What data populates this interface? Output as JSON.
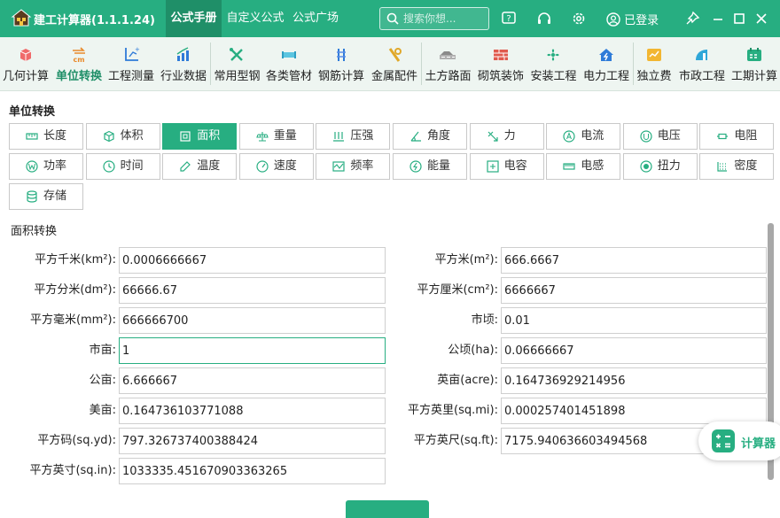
{
  "app": {
    "title": "建工计算器(1.1.1.24)",
    "brand_color": "#27ae81"
  },
  "menu": [
    "公式手册",
    "自定义公式",
    "公式广场"
  ],
  "search": {
    "placeholder": "搜索你想..."
  },
  "user": {
    "status": "已登录"
  },
  "toolbar": [
    {
      "label": "几何计算",
      "icon": "cube-icon"
    },
    {
      "label": "单位转换",
      "icon": "cm-convert-icon"
    },
    {
      "label": "工程测量",
      "icon": "axis-measure-icon"
    },
    {
      "label": "行业数据",
      "icon": "bar-chart-icon"
    },
    {
      "label": "常用型钢",
      "icon": "steel-tools-icon"
    },
    {
      "label": "各类管材",
      "icon": "pipe-icon"
    },
    {
      "label": "钢筋计算",
      "icon": "rebar-icon"
    },
    {
      "label": "金属配件",
      "icon": "metal-parts-icon"
    },
    {
      "label": "土方路面",
      "icon": "road-icon"
    },
    {
      "label": "砌筑装饰",
      "icon": "brick-wall-icon"
    },
    {
      "label": "安装工程",
      "icon": "fan-icon"
    },
    {
      "label": "电力工程",
      "icon": "power-house-icon"
    },
    {
      "label": "独立费",
      "icon": "fee-icon"
    },
    {
      "label": "市政工程",
      "icon": "municipal-icon"
    },
    {
      "label": "工期计算",
      "icon": "calendar-icon"
    }
  ],
  "section_title": "单位转换",
  "unit_types": [
    {
      "label": "长度",
      "icon": "ruler-icon"
    },
    {
      "label": "体积",
      "icon": "cube-outline-icon"
    },
    {
      "label": "面积",
      "icon": "area-icon"
    },
    {
      "label": "重量",
      "icon": "scale-icon"
    },
    {
      "label": "压强",
      "icon": "pressure-icon"
    },
    {
      "label": "角度",
      "icon": "angle-icon"
    },
    {
      "label": "力",
      "icon": "force-icon"
    },
    {
      "label": "电流",
      "icon": "ampere-icon"
    },
    {
      "label": "电压",
      "icon": "volt-icon"
    },
    {
      "label": "电阻",
      "icon": "resistor-icon"
    },
    {
      "label": "功率",
      "icon": "watt-icon"
    },
    {
      "label": "时间",
      "icon": "clock-icon"
    },
    {
      "label": "温度",
      "icon": "thermometer-icon"
    },
    {
      "label": "速度",
      "icon": "speedometer-icon"
    },
    {
      "label": "频率",
      "icon": "frequency-icon"
    },
    {
      "label": "能量",
      "icon": "energy-icon"
    },
    {
      "label": "电容",
      "icon": "capacitor-icon"
    },
    {
      "label": "电感",
      "icon": "inductor-icon"
    },
    {
      "label": "扭力",
      "icon": "torque-icon"
    },
    {
      "label": "密度",
      "icon": "density-icon"
    },
    {
      "label": "存储",
      "icon": "database-icon"
    }
  ],
  "active_unit": "面积",
  "group_title": "面积转换",
  "fields_left": [
    {
      "label": "平方千米(km²):",
      "value": "0.0006666667"
    },
    {
      "label": "平方分米(dm²):",
      "value": "66666.67"
    },
    {
      "label": "平方毫米(mm²):",
      "value": "666666700"
    },
    {
      "label": "市亩:",
      "value": "1"
    },
    {
      "label": "公亩:",
      "value": "6.666667"
    },
    {
      "label": "美亩:",
      "value": "0.164736103771088"
    },
    {
      "label": "平方码(sq.yd):",
      "value": "797.326737400388424"
    },
    {
      "label": "平方英寸(sq.in):",
      "value": "1033335.451670903363265"
    }
  ],
  "fields_right": [
    {
      "label": "平方米(m²):",
      "value": "666.6667"
    },
    {
      "label": "平方厘米(cm²):",
      "value": "6666667"
    },
    {
      "label": "市顷:",
      "value": "0.01"
    },
    {
      "label": "公顷(ha):",
      "value": "0.06666667"
    },
    {
      "label": "英亩(acre):",
      "value": "0.164736929214956"
    },
    {
      "label": "平方英里(sq.mi):",
      "value": "0.000257401451898"
    },
    {
      "label": "平方英尺(sq.ft):",
      "value": "7175.940636603494568"
    }
  ],
  "calculator": {
    "label": "计算器"
  }
}
